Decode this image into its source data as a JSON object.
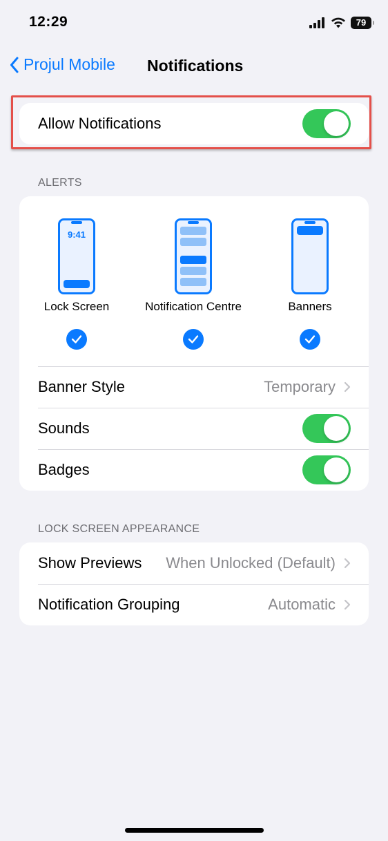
{
  "status_bar": {
    "time": "12:29",
    "battery": "79"
  },
  "nav": {
    "back_label": "Projul Mobile",
    "title": "Notifications"
  },
  "allow_notifications": {
    "label": "Allow Notifications",
    "on": true
  },
  "alerts": {
    "header": "ALERTS",
    "options": [
      {
        "label": "Lock Screen",
        "preview_time": "9:41",
        "checked": true
      },
      {
        "label": "Notification Centre",
        "checked": true
      },
      {
        "label": "Banners",
        "checked": true
      }
    ],
    "banner_style": {
      "label": "Banner Style",
      "value": "Temporary"
    },
    "sounds": {
      "label": "Sounds",
      "on": true
    },
    "badges": {
      "label": "Badges",
      "on": true
    }
  },
  "lock_screen_appearance": {
    "header": "LOCK SCREEN APPEARANCE",
    "show_previews": {
      "label": "Show Previews",
      "value": "When Unlocked (Default)"
    },
    "grouping": {
      "label": "Notification Grouping",
      "value": "Automatic"
    }
  },
  "colors": {
    "accent": "#0a7aff",
    "toggle_on": "#34c759",
    "highlight": "#e4504a"
  }
}
